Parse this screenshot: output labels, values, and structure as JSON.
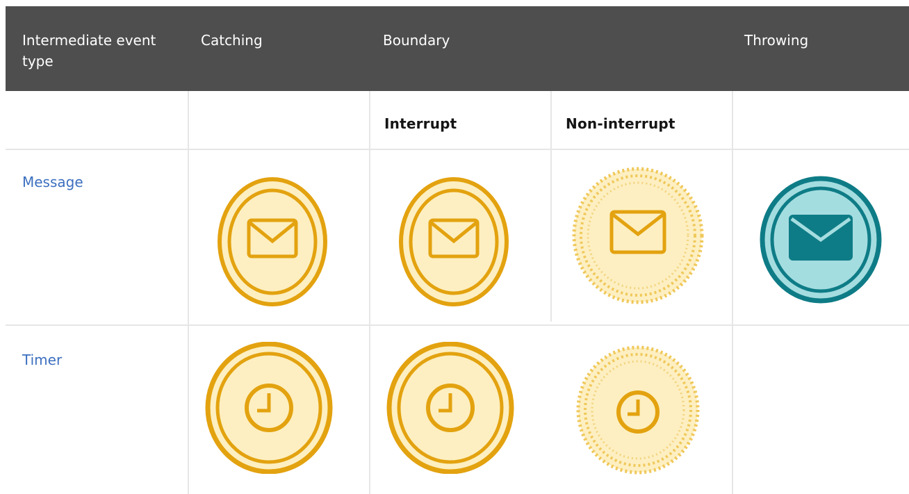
{
  "header": {
    "col_type": "Intermediate event type",
    "col_catching": "Catching",
    "col_boundary": "Boundary",
    "col_throwing": "Throwing"
  },
  "subheader": {
    "interrupt": "Interrupt",
    "non_interrupt": "Non-interrupt"
  },
  "rows": [
    {
      "label": "Message",
      "icons": [
        "message-catching-icon",
        "message-boundary-interrupt-icon",
        "message-boundary-non-interrupt-icon",
        "message-throwing-icon"
      ]
    },
    {
      "label": "Timer",
      "icons": [
        "timer-catching-icon",
        "timer-boundary-interrupt-icon",
        "timer-boundary-non-interrupt-icon"
      ]
    }
  ],
  "colors": {
    "header_bg": "#4e4e4e",
    "link": "#3c6fbf",
    "catch_stroke": "#e3a20f",
    "catch_fill": "#fdefc1",
    "throw_stroke": "#0e7c86",
    "throw_fill": "#a4dde0"
  }
}
